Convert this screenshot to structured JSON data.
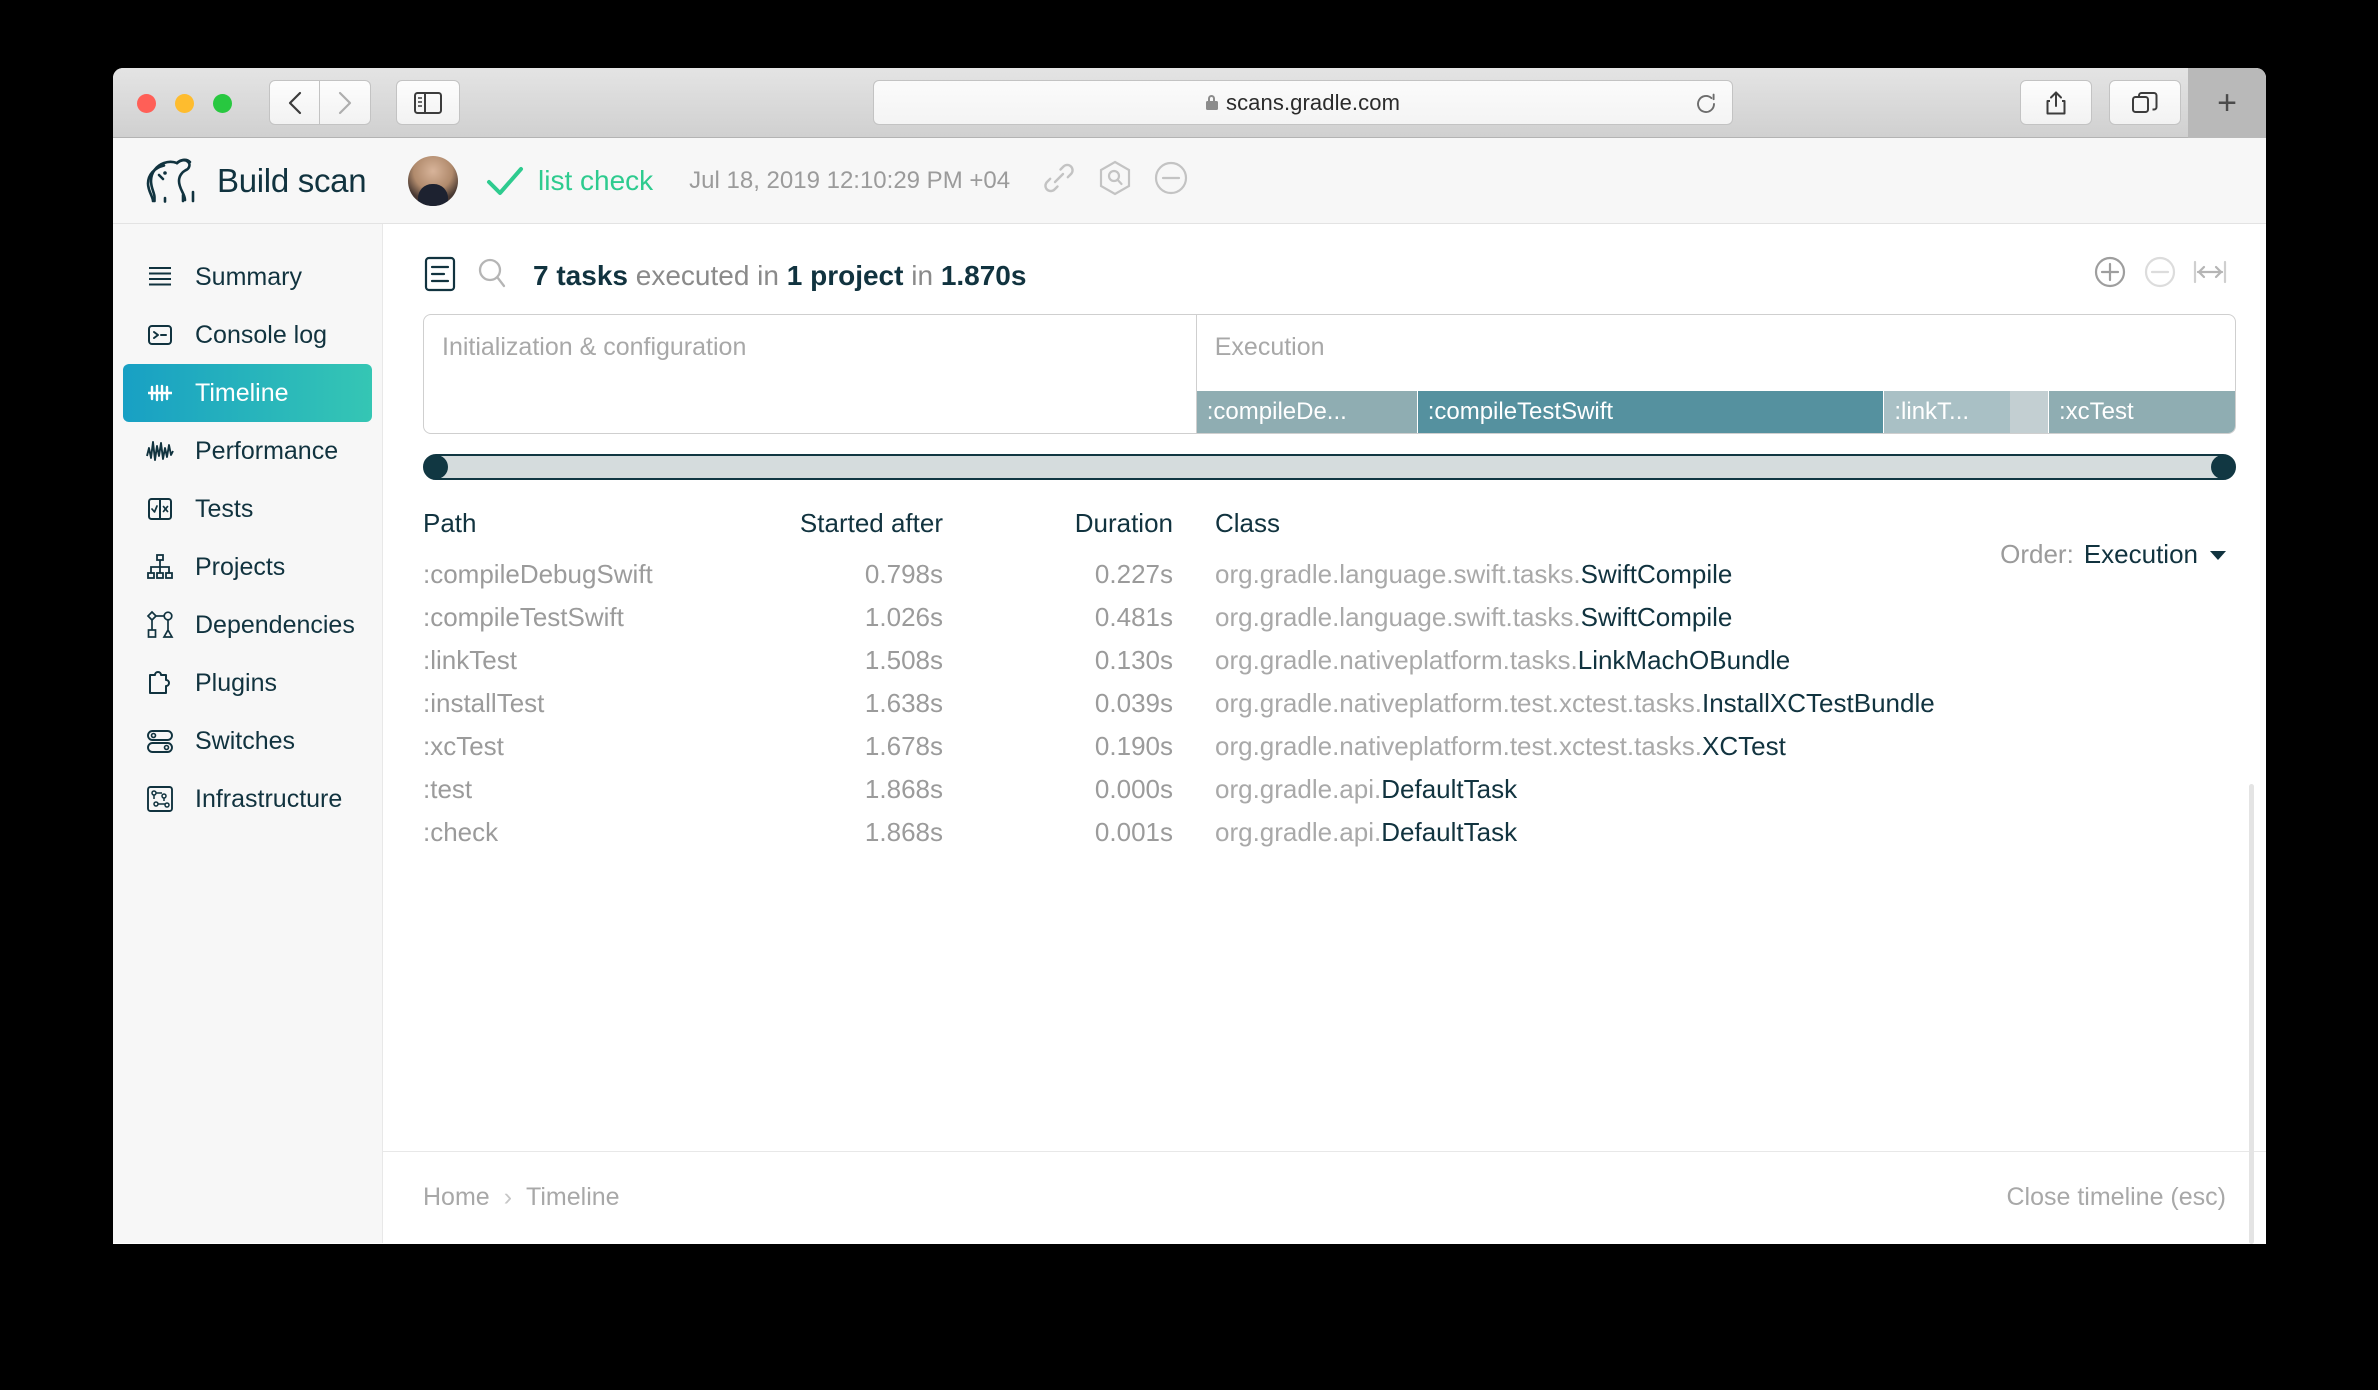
{
  "browser": {
    "url": "scans.gradle.com",
    "lock_icon": "lock-icon",
    "back_icon": "chevron-left-icon",
    "forward_icon": "chevron-right-icon",
    "sidebar_icon": "sidebar-toggle-icon",
    "reload_icon": "reload-icon",
    "share_icon": "share-icon",
    "tabs_icon": "show-tabs-icon",
    "newtab_label": "+"
  },
  "header": {
    "logo_icon": "gradle-elephant-icon",
    "logo_text": "Build scan",
    "avatar": "user-avatar",
    "status_icon": "check-icon",
    "tags": [
      "list",
      "check"
    ],
    "tags_text": "list  check",
    "date": "Jul 18, 2019 12:10:29 PM +04",
    "icons": [
      "link-icon",
      "search-hex-icon",
      "minus-circle-icon"
    ]
  },
  "sidebar": {
    "items": [
      {
        "label": "Summary",
        "icon": "lines-icon",
        "active": false
      },
      {
        "label": "Console log",
        "icon": "terminal-icon",
        "active": false
      },
      {
        "label": "Timeline",
        "icon": "timeline-icon",
        "active": true
      },
      {
        "label": "Performance",
        "icon": "waveform-icon",
        "active": false
      },
      {
        "label": "Tests",
        "icon": "test-split-icon",
        "active": false
      },
      {
        "label": "Projects",
        "icon": "hierarchy-icon",
        "active": false
      },
      {
        "label": "Dependencies",
        "icon": "dependency-icon",
        "active": false
      },
      {
        "label": "Plugins",
        "icon": "puzzle-icon",
        "active": false
      },
      {
        "label": "Switches",
        "icon": "toggles-icon",
        "active": false
      },
      {
        "label": "Infrastructure",
        "icon": "circuit-icon",
        "active": false
      }
    ]
  },
  "main": {
    "view_icon": "list-view-icon",
    "search_icon": "search-icon",
    "summary": {
      "tasks_count": "7 tasks",
      "mid1": " executed in ",
      "projects_count": "1 project",
      "mid2": " in ",
      "total_duration": "1.870s"
    },
    "zoom_controls": [
      {
        "icon": "zoom-in-icon",
        "enabled": true
      },
      {
        "icon": "zoom-out-icon",
        "enabled": false
      },
      {
        "icon": "fit-width-icon",
        "enabled": true
      }
    ],
    "order": {
      "label": "Order:",
      "value": "Execution",
      "icon": "chevron-down-icon"
    },
    "range_slider": {
      "start_pct": 0,
      "end_pct": 100
    },
    "vertical_scrollbar": "vertical-scrollbar"
  },
  "chart_data": {
    "type": "timeline",
    "title": "7 tasks executed in 1 project in 1.870s",
    "total_duration_s": 1.87,
    "xlim": [
      0,
      1.87
    ],
    "phases": [
      {
        "label": "Initialization & configuration",
        "start_s": 0.0,
        "end_s": 0.798
      },
      {
        "label": "Execution",
        "start_s": 0.798,
        "end_s": 1.87
      }
    ],
    "bars": [
      {
        "label": ":compileDe...",
        "full_label": ":compileDebugSwift",
        "start_s": 0.798,
        "duration_s": 0.227,
        "color": "#8fadb2"
      },
      {
        "label": ":compileTestSwift",
        "full_label": ":compileTestSwift",
        "start_s": 1.026,
        "duration_s": 0.481,
        "color": "#55919f"
      },
      {
        "label": ":linkT...",
        "full_label": ":linkTest",
        "start_s": 1.508,
        "duration_s": 0.13,
        "color": "#a9c0c5"
      },
      {
        "label": "",
        "full_label": ":installTest",
        "start_s": 1.638,
        "duration_s": 0.039,
        "color": "#c3cfd2"
      },
      {
        "label": ":xcTest",
        "full_label": ":xcTest",
        "start_s": 1.678,
        "duration_s": 0.19,
        "color": "#8fadb2"
      }
    ]
  },
  "table": {
    "columns": [
      "Path",
      "Started after",
      "Duration",
      "Class"
    ],
    "rows": [
      {
        "path": ":compileDebugSwift",
        "started": "0.798s",
        "duration": "0.227s",
        "duration_dim": false,
        "class_pkg": "org.gradle.language.swift.tasks.",
        "class_name": "SwiftCompile"
      },
      {
        "path": ":compileTestSwift",
        "started": "1.026s",
        "duration": "0.481s",
        "duration_dim": false,
        "class_pkg": "org.gradle.language.swift.tasks.",
        "class_name": "SwiftCompile"
      },
      {
        "path": ":linkTest",
        "started": "1.508s",
        "duration": "0.130s",
        "duration_dim": false,
        "class_pkg": "org.gradle.nativeplatform.tasks.",
        "class_name": "LinkMachOBundle"
      },
      {
        "path": ":installTest",
        "started": "1.638s",
        "duration": "0.039s",
        "duration_dim": false,
        "class_pkg": "org.gradle.nativeplatform.test.xctest.tasks.",
        "class_name": "InstallXCTestBundle"
      },
      {
        "path": ":xcTest",
        "started": "1.678s",
        "duration": "0.190s",
        "duration_dim": false,
        "class_pkg": "org.gradle.nativeplatform.test.xctest.tasks.",
        "class_name": "XCTest"
      },
      {
        "path": ":test",
        "started": "1.868s",
        "duration": "0.000s",
        "duration_dim": true,
        "class_pkg": "org.gradle.api.",
        "class_name": "DefaultTask"
      },
      {
        "path": ":check",
        "started": "1.868s",
        "duration": "0.001s",
        "duration_dim": false,
        "class_pkg": "org.gradle.api.",
        "class_name": "DefaultTask"
      }
    ]
  },
  "footer": {
    "breadcrumb": [
      "Home",
      "Timeline"
    ],
    "separator": "›",
    "close_label": "Close timeline (esc)"
  },
  "colors": {
    "accent_teal": "#2ecb8f",
    "brand_dark": "#11333f",
    "active_grad_from": "#18a0c4",
    "active_grad_to": "#35c6b4"
  }
}
